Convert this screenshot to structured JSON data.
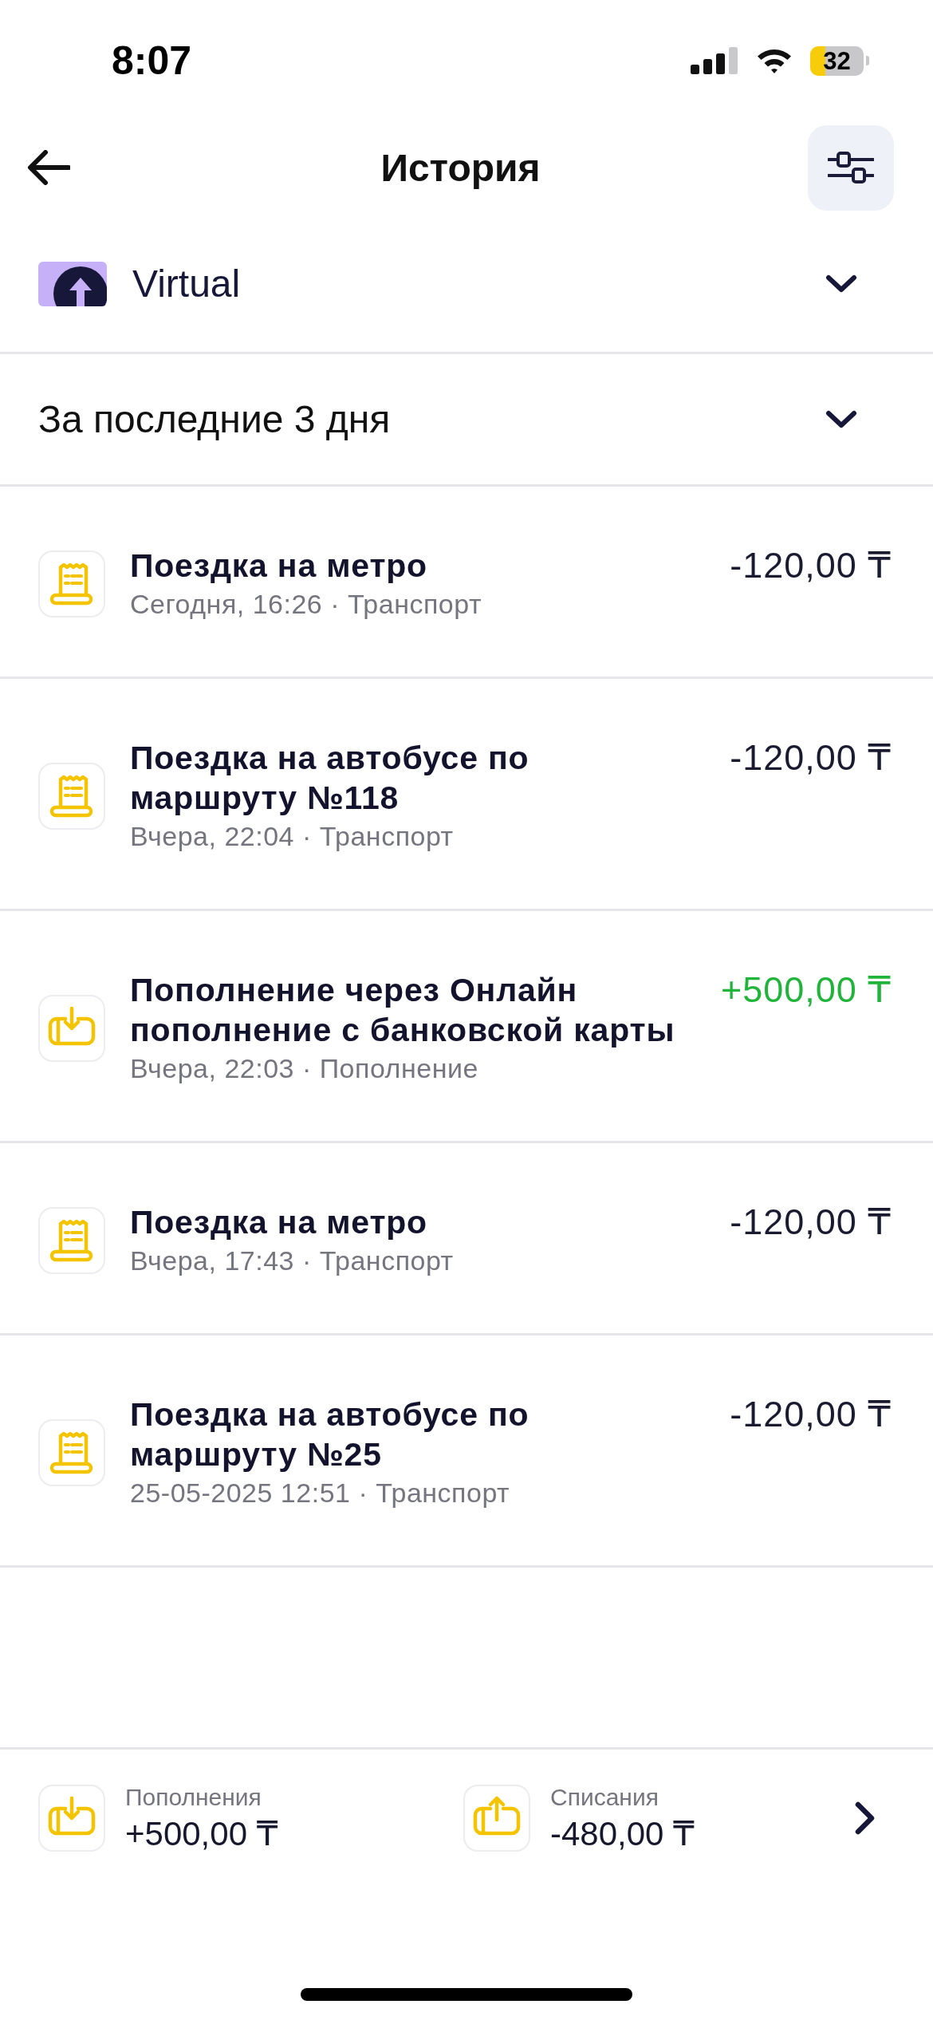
{
  "status_bar": {
    "time": "8:07",
    "battery": "32"
  },
  "header": {
    "title": "История"
  },
  "account": {
    "name": "Virtual"
  },
  "period": {
    "label": "За последние 3 дня"
  },
  "transactions": [
    {
      "kind": "expense",
      "title": "Поездка на метро",
      "meta": "Сегодня, 16:26 · Транспорт",
      "amount": "-120,00 ₸"
    },
    {
      "kind": "expense",
      "title": "Поездка на автобусе по маршруту №118",
      "meta": "Вчера, 22:04 · Транспорт",
      "amount": "-120,00 ₸"
    },
    {
      "kind": "income",
      "title": "Пополнение через Онлайн пополнение с банковской карты",
      "meta": "Вчера, 22:03 · Пополнение",
      "amount": "+500,00 ₸"
    },
    {
      "kind": "expense",
      "title": "Поездка на метро",
      "meta": "Вчера, 17:43 · Транспорт",
      "amount": "-120,00 ₸"
    },
    {
      "kind": "expense",
      "title": "Поездка на автобусе по маршруту №25",
      "meta": "25-05-2025 12:51 · Транспорт",
      "amount": "-120,00 ₸"
    }
  ],
  "summary": [
    {
      "kind": "income",
      "label": "Пополнения",
      "amount": "+500,00 ₸"
    },
    {
      "kind": "expense",
      "label": "Списания",
      "amount": "-480,00 ₸"
    }
  ]
}
